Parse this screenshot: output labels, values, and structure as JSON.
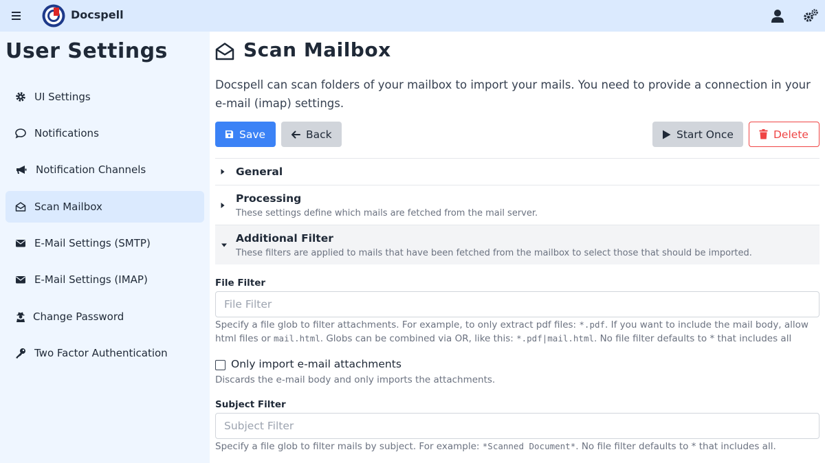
{
  "app": {
    "brand": "Docspell"
  },
  "sidebar": {
    "title": "User Settings",
    "items": [
      {
        "label": "UI Settings",
        "icon": "gear-icon"
      },
      {
        "label": "Notifications",
        "icon": "comment-icon"
      },
      {
        "label": "Notification Channels",
        "icon": "bullhorn-icon"
      },
      {
        "label": "Scan Mailbox",
        "icon": "envelope-open-icon",
        "active": true
      },
      {
        "label": "E-Mail Settings (SMTP)",
        "icon": "envelope-icon"
      },
      {
        "label": "E-Mail Settings (IMAP)",
        "icon": "envelope-icon"
      },
      {
        "label": "Change Password",
        "icon": "user-secret-icon"
      },
      {
        "label": "Two Factor Authentication",
        "icon": "key-icon"
      }
    ]
  },
  "main": {
    "title": "Scan Mailbox",
    "intro": "Docspell can scan folders of your mailbox to import your mails. You need to provide a connection in your e-mail (imap) settings.",
    "buttons": {
      "save": "Save",
      "back": "Back",
      "start_once": "Start Once",
      "delete": "Delete"
    },
    "sections": [
      {
        "title": "General",
        "subtitle": "",
        "expanded": false
      },
      {
        "title": "Processing",
        "subtitle": "These settings define which mails are fetched from the mail server.",
        "expanded": false
      },
      {
        "title": "Additional Filter",
        "subtitle": "These filters are applied to mails that have been fetched from the mailbox to select those that should be imported.",
        "expanded": true
      }
    ],
    "file_filter": {
      "label": "File Filter",
      "placeholder": "File Filter",
      "value": "",
      "help": {
        "p1": "Specify a file glob to filter attachments. For example, to only extract pdf files: ",
        "c1": "*.pdf",
        "p2": ". If you want to include the mail body, allow html files or ",
        "c2": "mail.html",
        "p3": ". Globs can be combined via OR, like this: ",
        "c3": "*.pdf|mail.html",
        "p4": ". No file filter defaults to * that includes all"
      }
    },
    "attachments_only": {
      "label": "Only import e-mail attachments",
      "checked": false,
      "help": "Discards the e-mail body and only imports the attachments."
    },
    "subject_filter": {
      "label": "Subject Filter",
      "placeholder": "Subject Filter",
      "value": "",
      "help": {
        "p1": "Specify a file glob to filter mails by subject. For example: ",
        "c1": "*Scanned Document*",
        "p2": ". No file filter defaults to * that includes all."
      }
    }
  },
  "colors": {
    "topbar": "#dbeafe",
    "sidebar": "#eff6ff",
    "primary": "#3b82f6",
    "danger": "#ef4444",
    "logo_ring": "#1e3a8a",
    "logo_accent": "#dc2626"
  }
}
